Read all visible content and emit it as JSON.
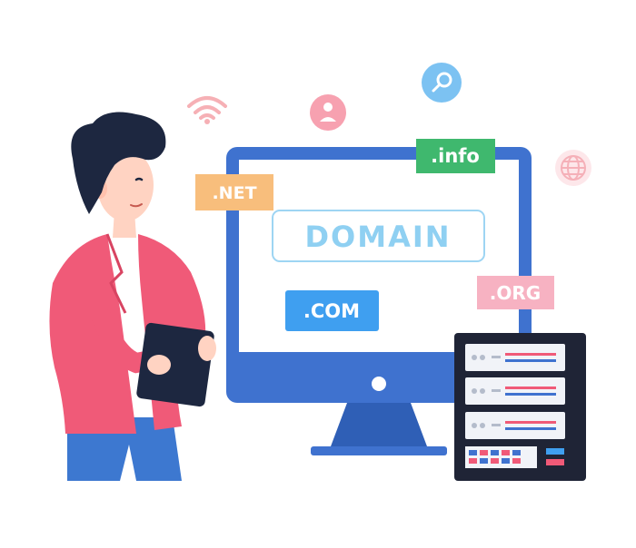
{
  "tags": {
    "domain": "DOMAIN",
    "net": ".NET",
    "info": ".info",
    "com": ".COM",
    "org": ".ORG"
  },
  "colors": {
    "monitor_blue": "#3f72cf",
    "screen_bg": "#ffffff",
    "jacket": "#f05a78",
    "pants": "#3d78d0",
    "hair": "#1d2740",
    "skin": "#ffd3c2",
    "net_tag": "#f8be7c",
    "info_tag": "#3fb86e",
    "com_tag": "#3f9ff0",
    "org_tag": "#f7b2c2",
    "domain_text": "#8fd0f2",
    "server_dark": "#1f2436"
  },
  "icons": [
    "wifi-icon",
    "user-icon",
    "search-icon",
    "globe-icon"
  ]
}
